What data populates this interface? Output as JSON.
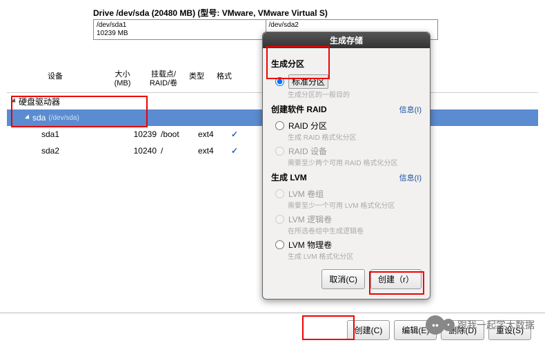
{
  "drive_header": "Drive /dev/sda (20480 MB) (型号: VMware, VMware Virtual S)",
  "partition_bar": [
    {
      "name": "/dev/sda1",
      "size": "10239 MB"
    },
    {
      "name": "/dev/sda2",
      "size": ""
    }
  ],
  "columns": {
    "device": "设备",
    "size": "大小\n(MB)",
    "mount": "挂载点/\nRAID/卷",
    "type": "类型",
    "format": "格式"
  },
  "tree": {
    "group_label": "硬盘驱动器",
    "disk": {
      "name": "sda",
      "path": "(/dev/sda)"
    },
    "partitions": [
      {
        "name": "sda1",
        "size": "10239",
        "mount": "/boot",
        "type": "ext4",
        "format": true
      },
      {
        "name": "sda2",
        "size": "10240",
        "mount": "/",
        "type": "ext4",
        "format": true
      }
    ]
  },
  "dialog": {
    "title": "生成存储",
    "sect_partition": "生成分区",
    "opt_std": "标准分区",
    "hint_std": "生成分区的一般目的",
    "sect_raid": "创建软件 RAID",
    "info": "信息(I)",
    "opt_raid_part": "RAID 分区",
    "hint_raid_part": "生成 RAID 格式化分区",
    "opt_raid_dev": "RAID 设备",
    "hint_raid_dev": "需要至少两个可用 RAID 格式化分区",
    "sect_lvm": "生成 LVM",
    "opt_lvm_vg": "LVM 卷组",
    "hint_lvm_vg": "需要至少一个可用 LVM 格式化分区",
    "opt_lvm_lv": "LVM 逻辑卷",
    "hint_lvm_lv": "在所选卷组中生成逻辑卷",
    "opt_lvm_pv": "LVM 物理卷",
    "hint_lvm_pv": "生成 LVM 格式化分区",
    "cancel": "取消(C)",
    "create": "创建（r）"
  },
  "bottom": {
    "create": "创建(C)",
    "edit": "编辑(E)",
    "delete": "删除(D)",
    "reset": "重设(S)"
  },
  "watermark": "跟我一起学大数据"
}
